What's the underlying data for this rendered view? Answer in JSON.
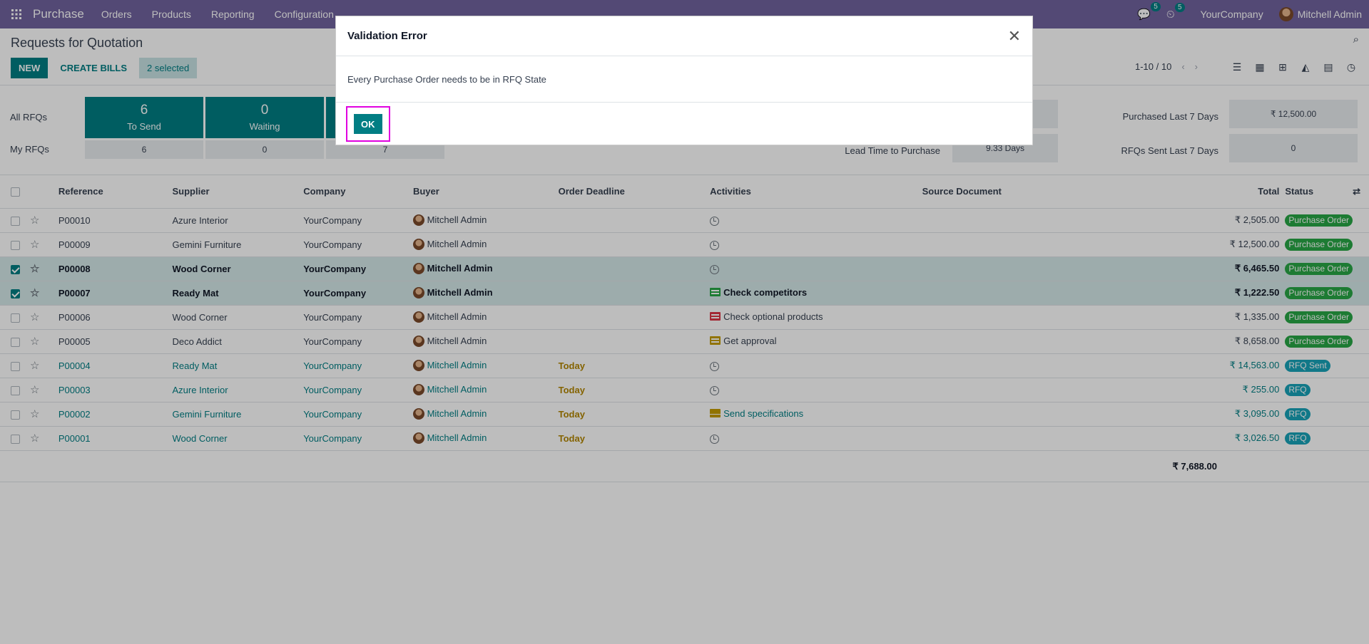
{
  "navbar": {
    "app_name": "Purchase",
    "menus": [
      "Orders",
      "Products",
      "Reporting",
      "Configuration"
    ],
    "messages_count": "5",
    "activities_count": "5",
    "company": "YourCompany",
    "user": "Mitchell Admin"
  },
  "control_panel": {
    "title": "Requests for Quotation",
    "new_label": "NEW",
    "create_bills_label": "CREATE BILLS",
    "selected_label": "2 selected",
    "pager": "1-10 / 10"
  },
  "dashboard": {
    "all_rfqs_label": "All RFQs",
    "my_rfqs_label": "My RFQs",
    "tiles": [
      {
        "value": "6",
        "caption": "To Send",
        "my": "6"
      },
      {
        "value": "0",
        "caption": "Waiting",
        "my": "0"
      },
      {
        "value": "",
        "caption": "",
        "my": "7"
      }
    ],
    "lead_time_label": "Lead Time to Purchase",
    "lead_time_value": "9.33 Days",
    "purchased_label": "Purchased Last 7 Days",
    "purchased_value": "₹ 12,500.00",
    "rfqs_sent_label": "RFQs Sent Last 7 Days",
    "rfqs_sent_value": "0"
  },
  "table": {
    "headers": {
      "reference": "Reference",
      "supplier": "Supplier",
      "company": "Company",
      "buyer": "Buyer",
      "deadline": "Order Deadline",
      "activities": "Activities",
      "source": "Source Document",
      "total": "Total",
      "status": "Status"
    },
    "rows": [
      {
        "ref": "P00010",
        "supplier": "Azure Interior",
        "company": "YourCompany",
        "buyer": "Mitchell Admin",
        "deadline": "",
        "activity": "",
        "total": "₹ 2,505.00",
        "status": "Purchase Order"
      },
      {
        "ref": "P00009",
        "supplier": "Gemini Furniture",
        "company": "YourCompany",
        "buyer": "Mitchell Admin",
        "deadline": "",
        "activity": "",
        "total": "₹ 12,500.00",
        "status": "Purchase Order"
      },
      {
        "ref": "P00008",
        "supplier": "Wood Corner",
        "company": "YourCompany",
        "buyer": "Mitchell Admin",
        "deadline": "",
        "activity": "",
        "total": "₹ 6,465.50",
        "status": "Purchase Order"
      },
      {
        "ref": "P00007",
        "supplier": "Ready Mat",
        "company": "YourCompany",
        "buyer": "Mitchell Admin",
        "deadline": "",
        "activity": "Check competitors",
        "total": "₹ 1,222.50",
        "status": "Purchase Order"
      },
      {
        "ref": "P00006",
        "supplier": "Wood Corner",
        "company": "YourCompany",
        "buyer": "Mitchell Admin",
        "deadline": "",
        "activity": "Check optional products",
        "total": "₹ 1,335.00",
        "status": "Purchase Order"
      },
      {
        "ref": "P00005",
        "supplier": "Deco Addict",
        "company": "YourCompany",
        "buyer": "Mitchell Admin",
        "deadline": "",
        "activity": "Get approval",
        "total": "₹ 8,658.00",
        "status": "Purchase Order"
      },
      {
        "ref": "P00004",
        "supplier": "Ready Mat",
        "company": "YourCompany",
        "buyer": "Mitchell Admin",
        "deadline": "Today",
        "activity": "",
        "total": "₹ 14,563.00",
        "status": "RFQ Sent"
      },
      {
        "ref": "P00003",
        "supplier": "Azure Interior",
        "company": "YourCompany",
        "buyer": "Mitchell Admin",
        "deadline": "Today",
        "activity": "",
        "total": "₹ 255.00",
        "status": "RFQ"
      },
      {
        "ref": "P00002",
        "supplier": "Gemini Furniture",
        "company": "YourCompany",
        "buyer": "Mitchell Admin",
        "deadline": "Today",
        "activity": "Send specifications",
        "total": "₹ 3,095.00",
        "status": "RFQ"
      },
      {
        "ref": "P00001",
        "supplier": "Wood Corner",
        "company": "YourCompany",
        "buyer": "Mitchell Admin",
        "deadline": "Today",
        "activity": "",
        "total": "₹ 3,026.50",
        "status": "RFQ"
      }
    ],
    "footer_total": "₹ 7,688.00"
  },
  "colors": {
    "accent": "#017e84",
    "navbar": "#71639e",
    "purchase_order_badge": "#28a745",
    "rfq_badge": "#17a2b8",
    "today": "#b38600",
    "highlight": "#e000e0"
  },
  "modal": {
    "title": "Validation Error",
    "message": "Every Purchase Order needs to be in RFQ State",
    "ok_label": "OK"
  }
}
